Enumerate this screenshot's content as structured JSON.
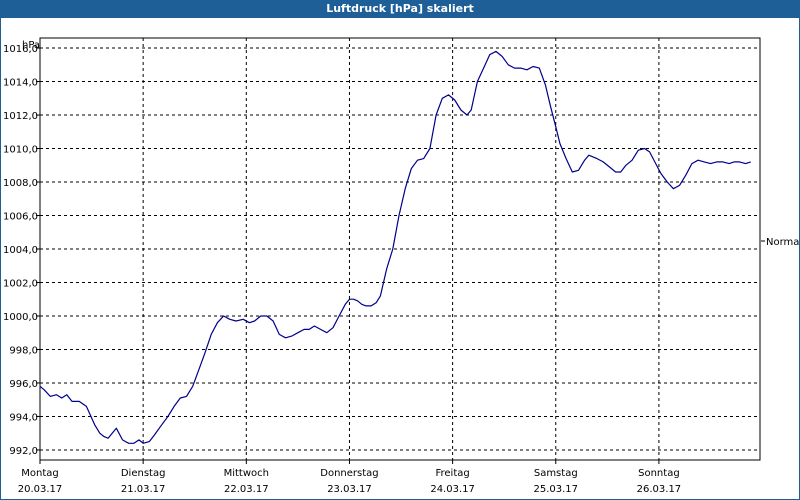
{
  "window": {
    "title": "Luftdruck [hPa] skaliert"
  },
  "chart_data": {
    "type": "line",
    "title": "Luftdruck [hPa] skaliert",
    "ylabel": "hPa",
    "xlabel": "",
    "ylim": [
      991.4,
      1016.6
    ],
    "xlim": [
      0,
      6.98
    ],
    "grid": true,
    "y_ticks": [
      "992,0",
      "994,0",
      "996,0",
      "998,0",
      "1000,0",
      "1002,0",
      "1004,0",
      "1006,0",
      "1008,0",
      "1010,0",
      "1012,0",
      "1014,0",
      "1016,0"
    ],
    "x_ticks": [
      {
        "day": "Montag",
        "date": "20.03.17"
      },
      {
        "day": "Dienstag",
        "date": "21.03.17"
      },
      {
        "day": "Mittwoch",
        "date": "22.03.17"
      },
      {
        "day": "Donnerstag",
        "date": "23.03.17"
      },
      {
        "day": "Freitag",
        "date": "24.03.17"
      },
      {
        "day": "Samstag",
        "date": "25.03.17"
      },
      {
        "day": "Sonntag",
        "date": "26.03.17"
      }
    ],
    "legend": {
      "label": "Normal",
      "position": "right"
    },
    "series": [
      {
        "name": "Normal",
        "color": "#00008b",
        "x": [
          0.0,
          0.04,
          0.1,
          0.16,
          0.21,
          0.26,
          0.31,
          0.38,
          0.45,
          0.53,
          0.58,
          0.62,
          0.66,
          0.74,
          0.8,
          0.86,
          0.91,
          0.96,
          1.0,
          1.06,
          1.11,
          1.18,
          1.24,
          1.3,
          1.36,
          1.42,
          1.48,
          1.54,
          1.6,
          1.66,
          1.72,
          1.78,
          1.84,
          1.9,
          1.97,
          2.03,
          2.08,
          2.14,
          2.2,
          2.26,
          2.32,
          2.38,
          2.44,
          2.5,
          2.56,
          2.61,
          2.66,
          2.72,
          2.78,
          2.84,
          2.9,
          2.96,
          3.0,
          3.04,
          3.08,
          3.12,
          3.16,
          3.21,
          3.26,
          3.3,
          3.36,
          3.42,
          3.48,
          3.54,
          3.6,
          3.66,
          3.72,
          3.78,
          3.84,
          3.9,
          3.96,
          4.02,
          4.08,
          4.14,
          4.18,
          4.24,
          4.3,
          4.36,
          4.42,
          4.48,
          4.54,
          4.6,
          4.66,
          4.72,
          4.78,
          4.84,
          4.9,
          4.95,
          5.0,
          5.04,
          5.1,
          5.16,
          5.22,
          5.28,
          5.32,
          5.4,
          5.46,
          5.52,
          5.58,
          5.63,
          5.68,
          5.74,
          5.8,
          5.86,
          5.91,
          5.96,
          6.02,
          6.08,
          6.14,
          6.2,
          6.26,
          6.32,
          6.38,
          6.44,
          6.5,
          6.56,
          6.62,
          6.68,
          6.73,
          6.78,
          6.84,
          6.89
        ],
        "values": [
          995.8,
          995.6,
          995.2,
          995.3,
          995.1,
          995.3,
          994.9,
          994.9,
          994.6,
          993.5,
          993.0,
          992.8,
          992.7,
          993.3,
          992.6,
          992.4,
          992.4,
          992.6,
          992.4,
          992.5,
          992.9,
          993.5,
          994.0,
          994.6,
          995.1,
          995.2,
          995.8,
          996.8,
          997.8,
          998.9,
          999.6,
          1000.0,
          999.8,
          999.7,
          999.8,
          999.6,
          999.7,
          1000.0,
          1000.0,
          999.7,
          998.9,
          998.7,
          998.8,
          999.0,
          999.2,
          999.2,
          999.4,
          999.2,
          999.0,
          999.3,
          1000.0,
          1000.7,
          1001.0,
          1001.0,
          1000.9,
          1000.7,
          1000.6,
          1000.6,
          1000.8,
          1001.2,
          1002.8,
          1004.0,
          1006.0,
          1007.6,
          1008.8,
          1009.3,
          1009.4,
          1010.0,
          1012.0,
          1013.0,
          1013.2,
          1012.9,
          1012.3,
          1012.0,
          1012.3,
          1014.0,
          1014.8,
          1015.6,
          1015.8,
          1015.5,
          1015.0,
          1014.8,
          1014.8,
          1014.7,
          1014.9,
          1014.8,
          1013.8,
          1012.5,
          1011.3,
          1010.3,
          1009.4,
          1008.6,
          1008.7,
          1009.3,
          1009.6,
          1009.4,
          1009.2,
          1008.9,
          1008.6,
          1008.6,
          1009.0,
          1009.3,
          1009.9,
          1010.0,
          1009.8,
          1009.2,
          1008.5,
          1008.0,
          1007.6,
          1007.8,
          1008.4,
          1009.1,
          1009.3,
          1009.2,
          1009.1,
          1009.2,
          1009.2,
          1009.1,
          1009.2,
          1009.2,
          1009.1,
          1009.2
        ]
      }
    ]
  }
}
